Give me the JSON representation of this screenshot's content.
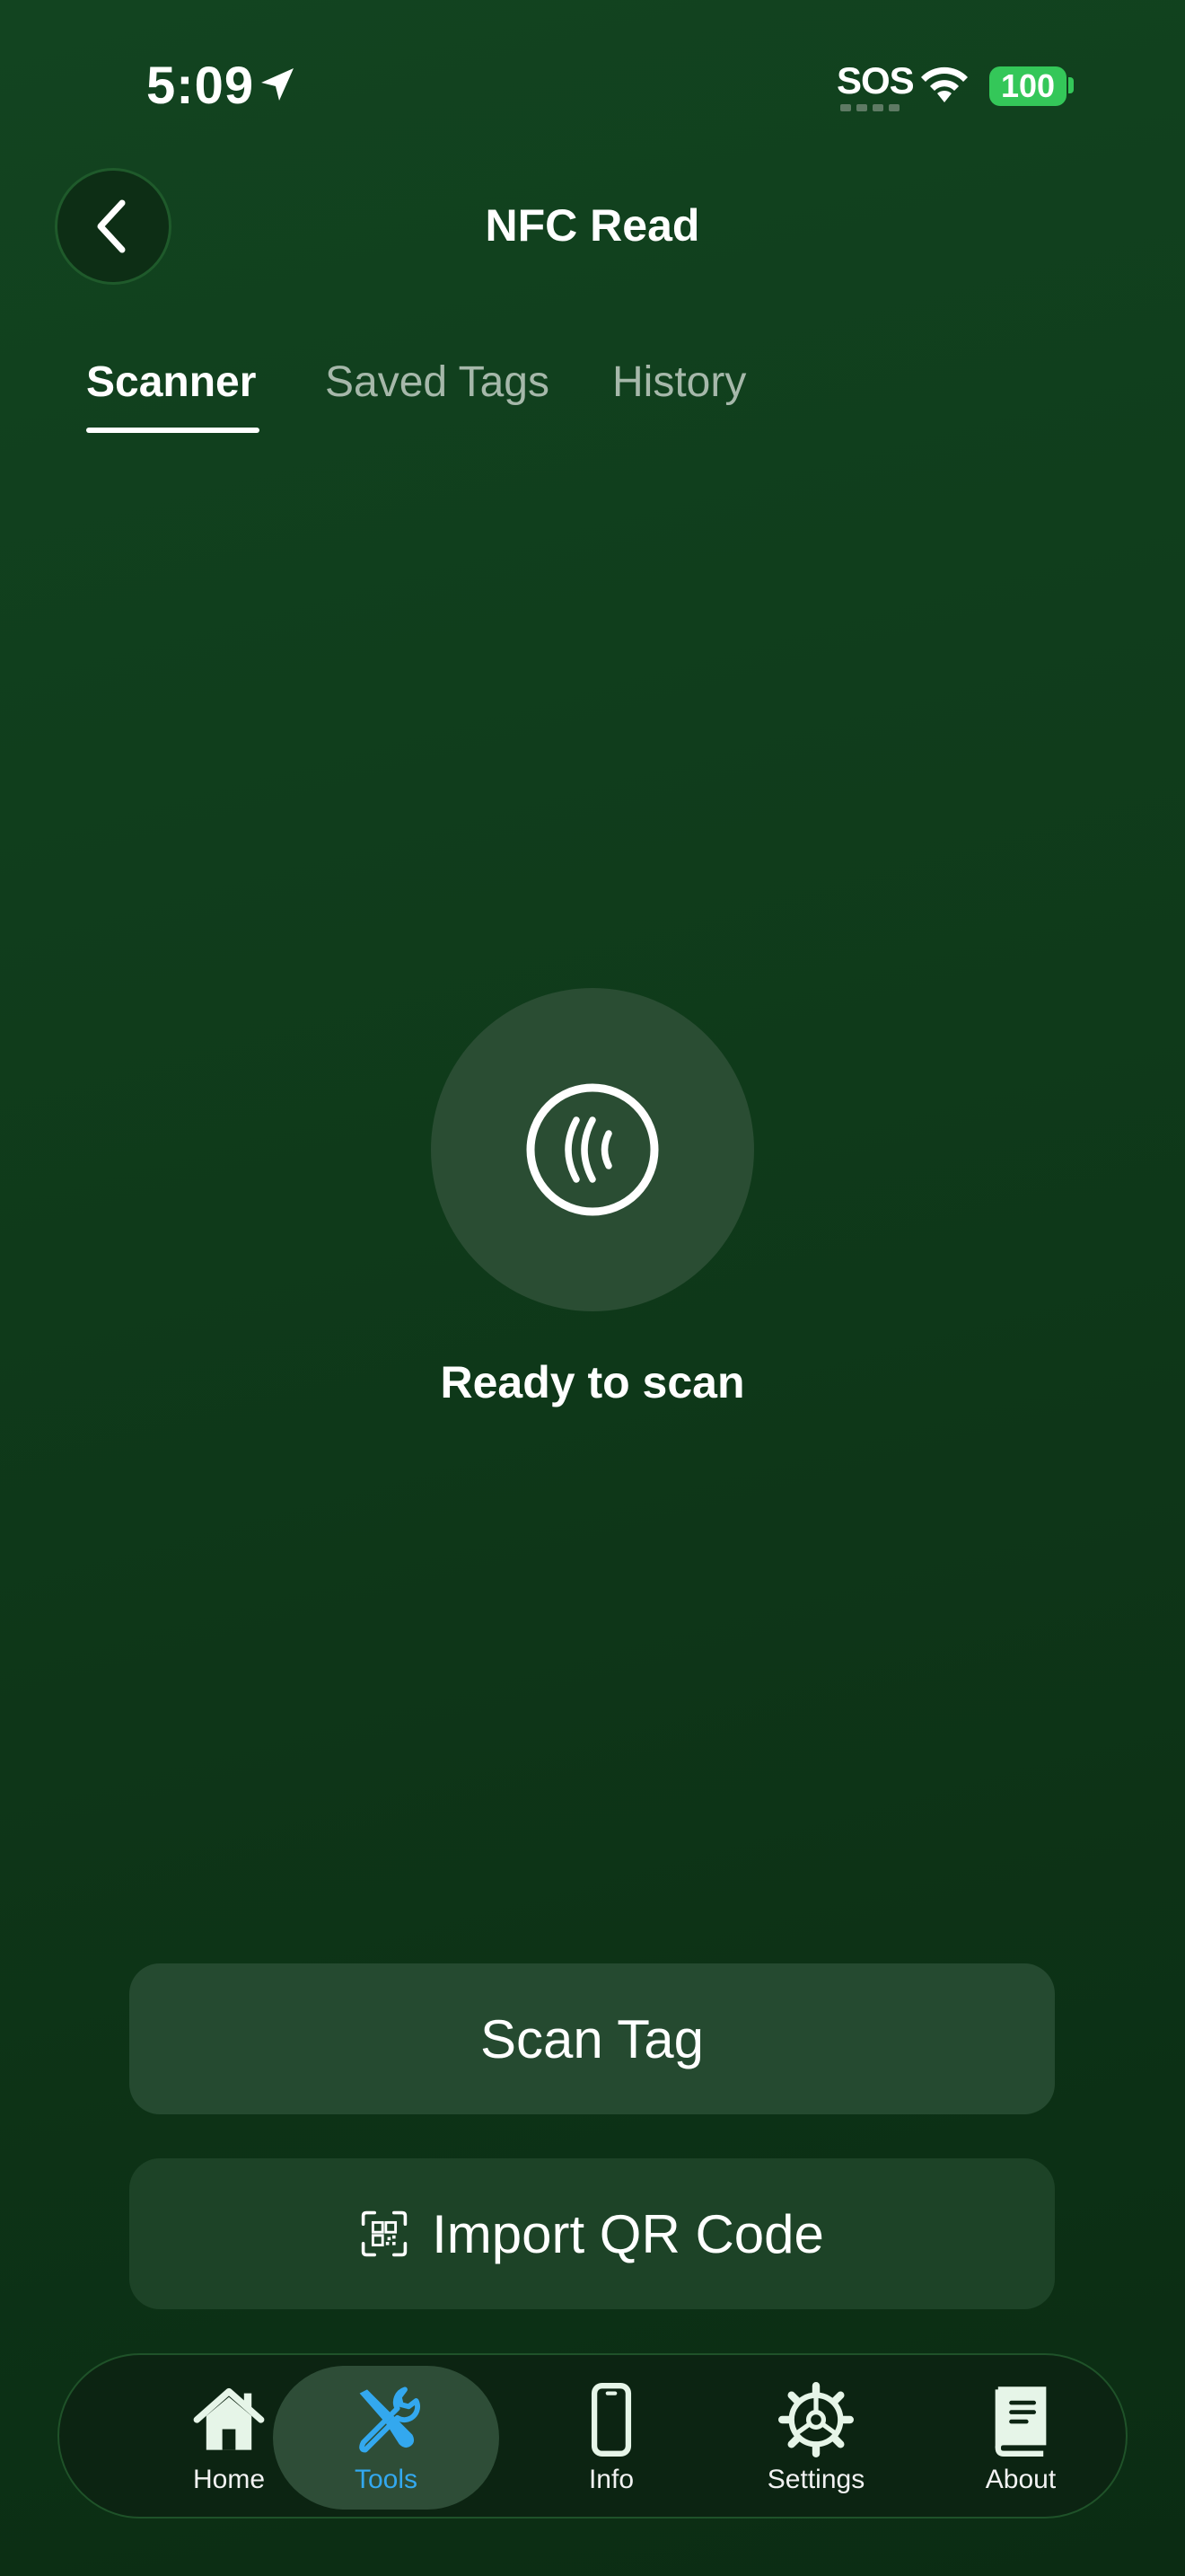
{
  "status_bar": {
    "time": "5:09",
    "sos": "SOS",
    "battery": "100",
    "icons": [
      "location-arrow-icon",
      "wifi-icon",
      "battery-icon"
    ]
  },
  "header": {
    "title": "NFC Read",
    "back_icon": "chevron-left-icon"
  },
  "tabs": [
    {
      "label": "Scanner",
      "active": true
    },
    {
      "label": "Saved Tags",
      "active": false
    },
    {
      "label": "History",
      "active": false
    }
  ],
  "scanner": {
    "icon": "nfc-icon",
    "status_text": "Ready to scan"
  },
  "actions": {
    "scan_label": "Scan Tag",
    "import_label": "Import QR Code",
    "import_icon": "qr-code-icon"
  },
  "tab_bar": {
    "items": [
      {
        "label": "Home",
        "icon": "house-icon",
        "active": false
      },
      {
        "label": "Tools",
        "icon": "tools-icon",
        "active": true
      },
      {
        "label": "Info",
        "icon": "phone-icon",
        "active": false
      },
      {
        "label": "Settings",
        "icon": "gear-icon",
        "active": false
      },
      {
        "label": "About",
        "icon": "book-icon",
        "active": false
      }
    ]
  },
  "colors": {
    "background": "#0f3a1a",
    "accent": "#33a8ef",
    "battery": "#34c759"
  }
}
